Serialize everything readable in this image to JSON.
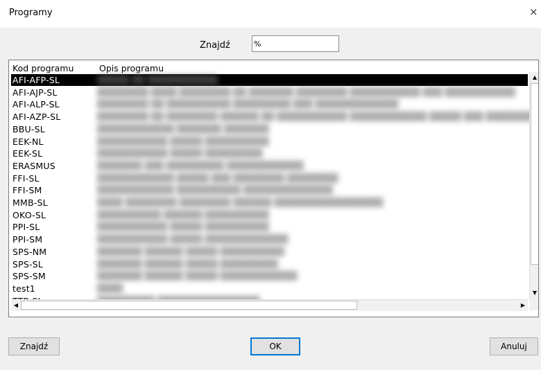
{
  "window": {
    "title": "Programy",
    "close_glyph": "×"
  },
  "search": {
    "label": "Znajdź",
    "value": "%"
  },
  "table": {
    "headers": {
      "code": "Kod programu",
      "description": "Opis programu"
    },
    "rows": [
      {
        "code": "AFI-AFP-SL",
        "description": "█████ ██ ███████████",
        "selected": true
      },
      {
        "code": "AFI-AJP-SL",
        "description": "████████ ████ ████████ ██ ███████ ████████ ███████████ ███ ███████████"
      },
      {
        "code": "AFI-ALP-SL",
        "description": "████████ ██ ██████████ █████████ ███ █████████████"
      },
      {
        "code": "AFI-AZP-SL",
        "description": "████████ ██ ████████ ██████ ██ ███████████ ████████████ █████ ███ ███████████"
      },
      {
        "code": "BBU-SL",
        "description": "████████████ ███████ ███████"
      },
      {
        "code": "EEK-NL",
        "description": "███████████ █████ ██████████"
      },
      {
        "code": "EEK-SL",
        "description": "███████████ █████ █████████"
      },
      {
        "code": "ERASMUS",
        "description": "███████ ███ █████████ ████████████"
      },
      {
        "code": "FFI-SL",
        "description": "████████████ █████ ███ ████████ ████████"
      },
      {
        "code": "FFI-SM",
        "description": "████████████ ██████████ ██████████████"
      },
      {
        "code": "MMB-SL",
        "description": "████ ████████ ████████ ██████ █████████████████"
      },
      {
        "code": "OKO-SL",
        "description": "██████████ ██████ ██████████"
      },
      {
        "code": "PPI-SL",
        "description": "███████████ █████ ██████████"
      },
      {
        "code": "PPI-SM",
        "description": "███████████ █████ █████████████"
      },
      {
        "code": "SPS-NM",
        "description": "███████ ██████ █████ ██████████"
      },
      {
        "code": "SPS-SL",
        "description": "███████ ██████ █████ █████████"
      },
      {
        "code": "SPS-SM",
        "description": "███████ ██████ █████ ████████████"
      },
      {
        "code": "test1",
        "description": "████"
      },
      {
        "code": "TTR-SL",
        "description": "█████████ ████████████████"
      }
    ]
  },
  "buttons": {
    "find": "Znajdź",
    "ok": "OK",
    "cancel": "Anuluj"
  },
  "icons": {
    "close": "close-icon",
    "scroll_up": "arrow-up-icon",
    "scroll_down": "arrow-down-icon",
    "scroll_left": "arrow-left-icon",
    "scroll_right": "arrow-right-icon"
  },
  "colors": {
    "selection_bg": "#000000",
    "selection_fg": "#ffffff",
    "default_button_border": "#0078d7",
    "window_bg": "#f0f0f0"
  }
}
